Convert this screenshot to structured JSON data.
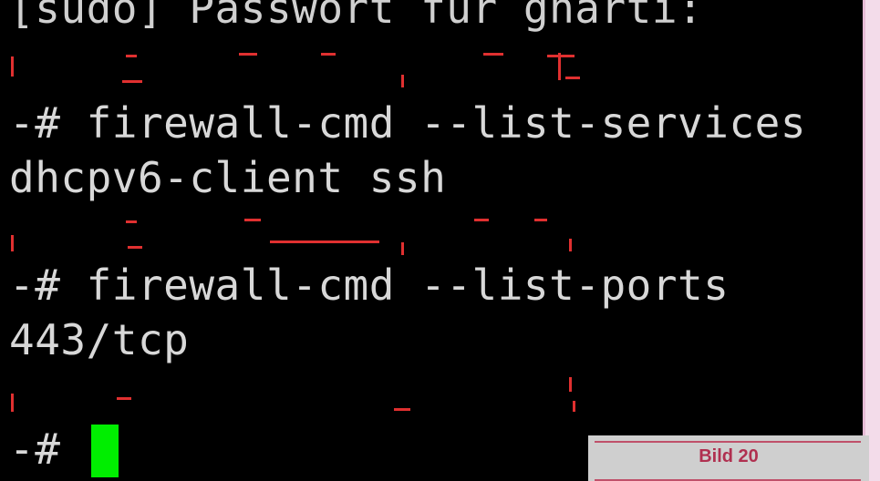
{
  "terminal": {
    "lines": {
      "sudo_prompt": "[sudo] Passwort für gharti:",
      "cmd_services": "-# firewall-cmd --list-services",
      "out_services": "dhcpv6-client ssh",
      "cmd_ports": "-# firewall-cmd --list-ports",
      "out_ports": "443/tcp",
      "final_prompt": "-#"
    },
    "colors": {
      "background": "#000000",
      "text": "#d8d8d8",
      "cursor": "#00ee00",
      "redaction": "#e03030"
    }
  },
  "caption": {
    "label": "Bild 20",
    "color": "#b03050"
  }
}
